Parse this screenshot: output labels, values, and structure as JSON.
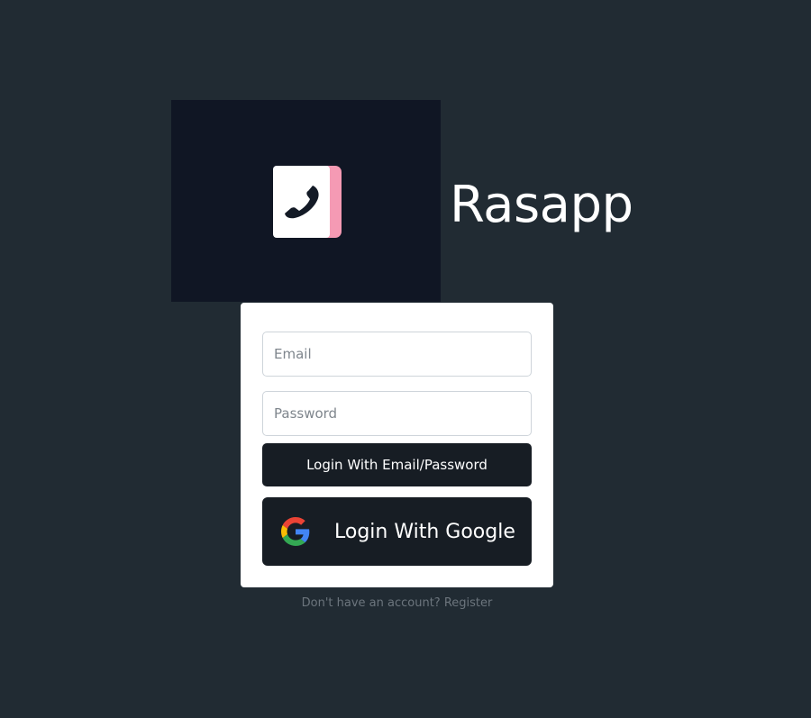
{
  "app": {
    "name": "Rasapp",
    "logo_icon": "phone-book-icon",
    "colors": {
      "background": "#212b33",
      "logo_panel": "#101624",
      "logo_accent": "#f59ab4",
      "button": "#171d24"
    }
  },
  "login_form": {
    "email": {
      "value": "",
      "placeholder": "Email"
    },
    "password": {
      "value": "",
      "placeholder": "Password"
    },
    "email_login_label": "Login With Email/Password",
    "google_login_label": "Login With Google",
    "google_icon": "google-g-icon"
  },
  "footer": {
    "prompt": "Don't have an account?",
    "register_label": "Register"
  }
}
